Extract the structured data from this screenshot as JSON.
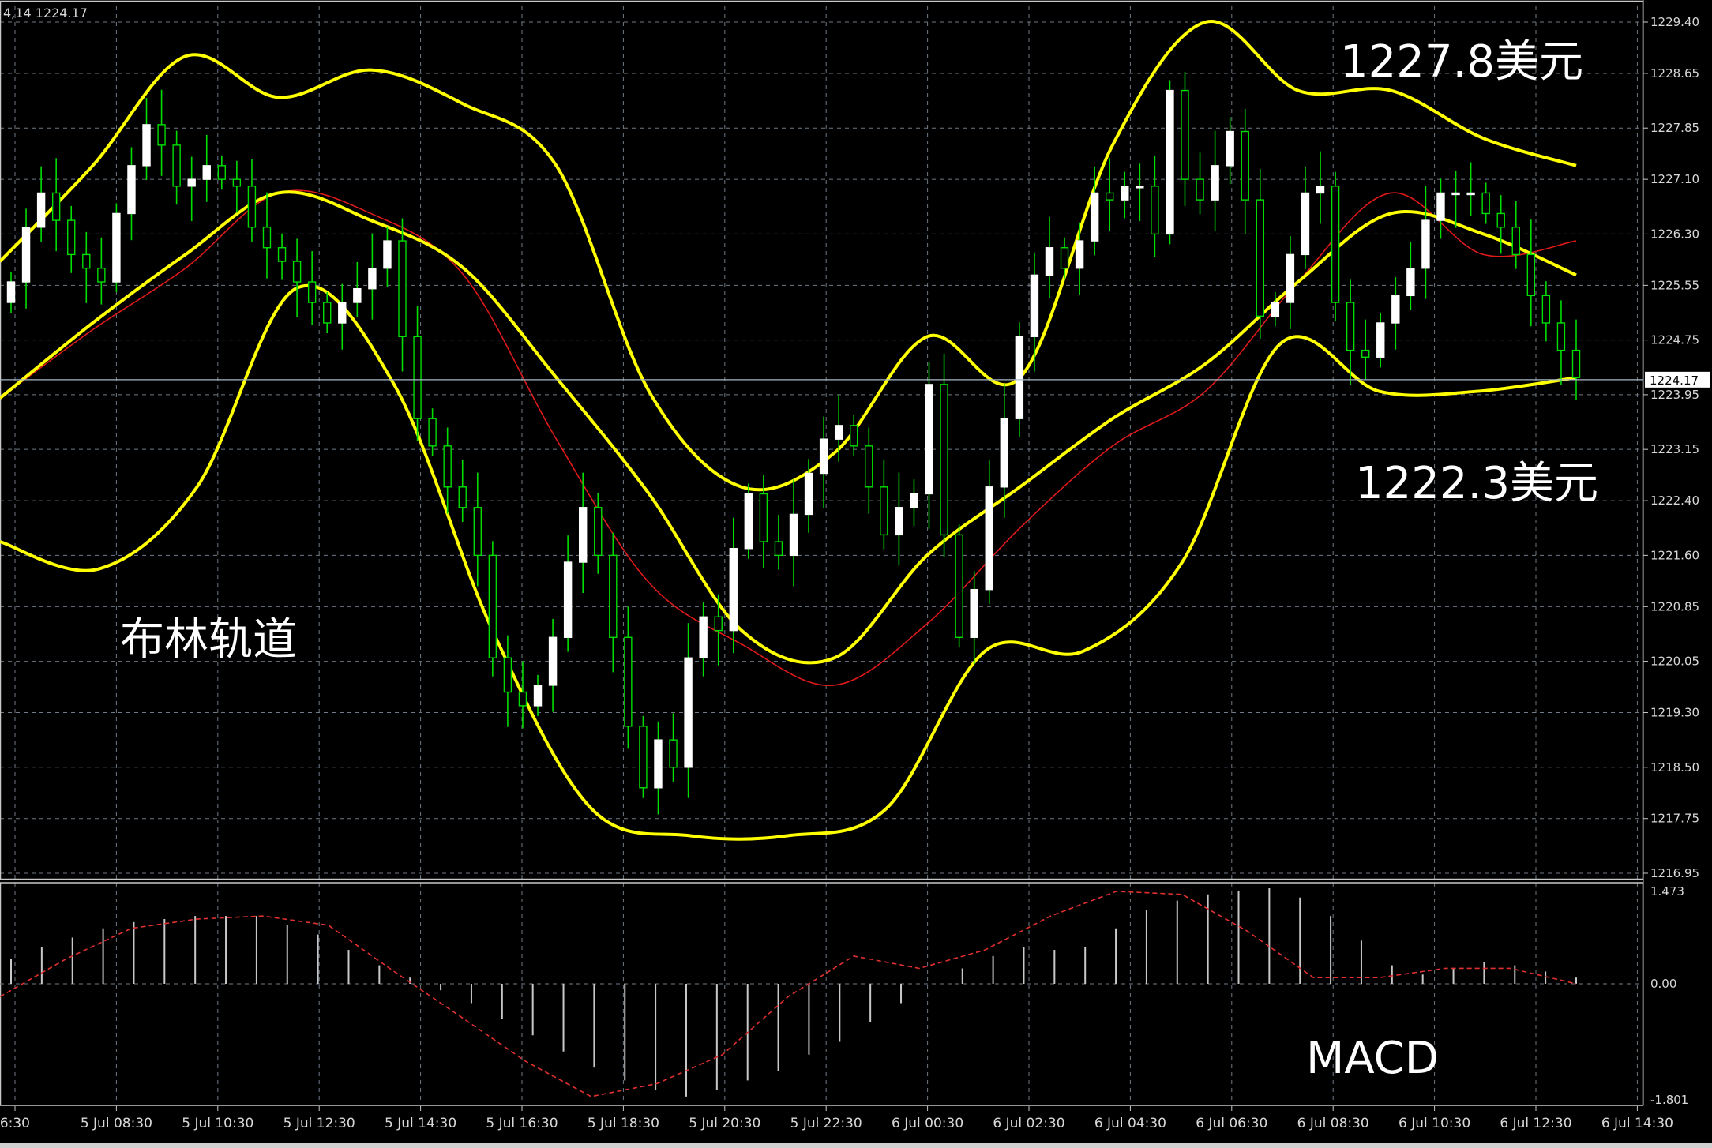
{
  "header": {
    "text": "4,14 1224.17"
  },
  "colors": {
    "background": "#000000",
    "grid": "#6e7a86",
    "axis_text": "#d8d8d8",
    "bull_candle": "#ffffff",
    "wick": "#00dd00",
    "bollinger": "#ffff00",
    "ma": "#e01a1a",
    "macd_hist": "#c8c8c8",
    "macd_signal": "#e03030",
    "annotation": "#ffffff"
  },
  "annotations": {
    "upper_price": "1227.8美元",
    "lower_price": "1222.3美元",
    "bollinger": "布林轨道",
    "macd": "MACD"
  },
  "chart_data": [
    {
      "type": "candlestick",
      "title": "",
      "indicators": [
        "Bollinger Bands",
        "Moving Average"
      ],
      "ylim": [
        1216.95,
        1229.4
      ],
      "y_ticks": [
        "1229.40",
        "1228.65",
        "1227.85",
        "1227.10",
        "1226.30",
        "1225.55",
        "1224.75",
        "1223.95",
        "1223.15",
        "1222.40",
        "1221.60",
        "1220.85",
        "1220.05",
        "1219.30",
        "1218.50",
        "1217.75",
        "1216.95"
      ],
      "current_price": "1224.17",
      "x_labels": [
        "6:30",
        "5 Jul 08:30",
        "5 Jul 10:30",
        "5 Jul 12:30",
        "5 Jul 14:30",
        "5 Jul 16:30",
        "5 Jul 18:30",
        "5 Jul 20:30",
        "5 Jul 22:30",
        "6 Jul 00:30",
        "6 Jul 02:30",
        "6 Jul 04:30",
        "6 Jul 06:30",
        "6 Jul 08:30",
        "6 Jul 10:30",
        "6 Jul 12:30",
        "6 Jul 14:30"
      ],
      "close": [
        1225.6,
        1226.4,
        1226.9,
        1226.5,
        1226.0,
        1225.8,
        1225.6,
        1226.6,
        1227.3,
        1227.9,
        1227.6,
        1227.0,
        1227.1,
        1227.3,
        1227.1,
        1227.0,
        1226.4,
        1226.1,
        1225.9,
        1225.6,
        1225.3,
        1225.0,
        1225.3,
        1225.5,
        1225.8,
        1226.2,
        1224.8,
        1223.6,
        1223.2,
        1222.6,
        1222.3,
        1221.6,
        1220.1,
        1219.6,
        1219.4,
        1219.7,
        1220.4,
        1221.5,
        1222.3,
        1221.6,
        1220.4,
        1219.1,
        1218.2,
        1218.9,
        1218.5,
        1220.1,
        1220.7,
        1220.5,
        1221.7,
        1222.5,
        1221.8,
        1221.6,
        1222.2,
        1222.8,
        1223.3,
        1223.5,
        1223.2,
        1222.6,
        1221.9,
        1222.3,
        1222.5,
        1224.1,
        1221.9,
        1220.4,
        1221.1,
        1222.6,
        1223.6,
        1224.8,
        1225.7,
        1226.1,
        1225.8,
        1226.2,
        1226.9,
        1226.8,
        1227.0,
        1227.0,
        1226.3,
        1228.4,
        1227.1,
        1226.8,
        1227.3,
        1227.8,
        1226.8,
        1225.1,
        1225.3,
        1226.0,
        1226.9,
        1227.0,
        1225.3,
        1224.6,
        1224.5,
        1225.0,
        1225.4,
        1225.8,
        1226.5,
        1226.9,
        1226.9,
        1226.9,
        1226.6,
        1226.4,
        1226.0,
        1225.4,
        1225.0,
        1224.6,
        1224.2
      ],
      "bollinger_upper_ref": [
        1225.9,
        1227.3,
        1228.9,
        1228.3,
        1228.7,
        1228.2,
        1227.3,
        1224.0,
        1222.6,
        1223.1,
        1224.8,
        1224.2,
        1227.6,
        1229.4,
        1228.4,
        1228.4,
        1227.7,
        1227.3
      ],
      "bollinger_middle_ref": [
        1223.9,
        1225.0,
        1226.0,
        1226.9,
        1226.5,
        1225.8,
        1224.2,
        1222.5,
        1220.5,
        1220.1,
        1221.6,
        1222.6,
        1223.6,
        1224.4,
        1225.6,
        1226.6,
        1226.3,
        1225.7
      ],
      "bollinger_lower_ref": [
        1221.8,
        1221.4,
        1222.6,
        1225.5,
        1224.1,
        1220.5,
        1217.9,
        1217.5,
        1217.5,
        1217.9,
        1220.2,
        1220.2,
        1221.5,
        1224.7,
        1224.0,
        1224.0,
        1224.2
      ],
      "ma_ref": [
        1223.9,
        1224.9,
        1225.8,
        1226.9,
        1226.6,
        1225.7,
        1223.3,
        1221.2,
        1220.3,
        1219.7,
        1220.6,
        1222.0,
        1223.2,
        1224.0,
        1225.6,
        1226.9,
        1226.0,
        1226.2
      ],
      "last_price": "1224.17"
    },
    {
      "type": "macd",
      "title": "MACD",
      "ylim": [
        -1.801,
        1.473
      ],
      "y_ticks": [
        "1.473",
        "0.00",
        "-1.801"
      ],
      "histogram": [
        0.4,
        0.6,
        0.75,
        0.9,
        1.0,
        1.05,
        1.1,
        1.1,
        1.1,
        0.95,
        0.8,
        0.55,
        0.3,
        0.1,
        -0.1,
        -0.3,
        -0.55,
        -0.8,
        -1.05,
        -1.3,
        -1.5,
        -1.65,
        -1.75,
        -1.65,
        -1.5,
        -1.35,
        -1.1,
        -0.9,
        -0.6,
        -0.3,
        0.0,
        0.25,
        0.45,
        0.6,
        0.55,
        0.6,
        0.9,
        1.2,
        1.35,
        1.45,
        1.5,
        1.55,
        1.4,
        1.1,
        0.7,
        0.3,
        0.15,
        0.25,
        0.35,
        0.3,
        0.2,
        0.1
      ],
      "signal_ref": [
        -0.2,
        0.4,
        0.9,
        1.05,
        1.1,
        0.95,
        0.2,
        -0.5,
        -1.2,
        -1.75,
        -1.55,
        -1.1,
        -0.2,
        0.45,
        0.25,
        0.55,
        1.1,
        1.5,
        1.45,
        0.85,
        0.1,
        0.1,
        0.25,
        0.25,
        0.0
      ]
    }
  ]
}
